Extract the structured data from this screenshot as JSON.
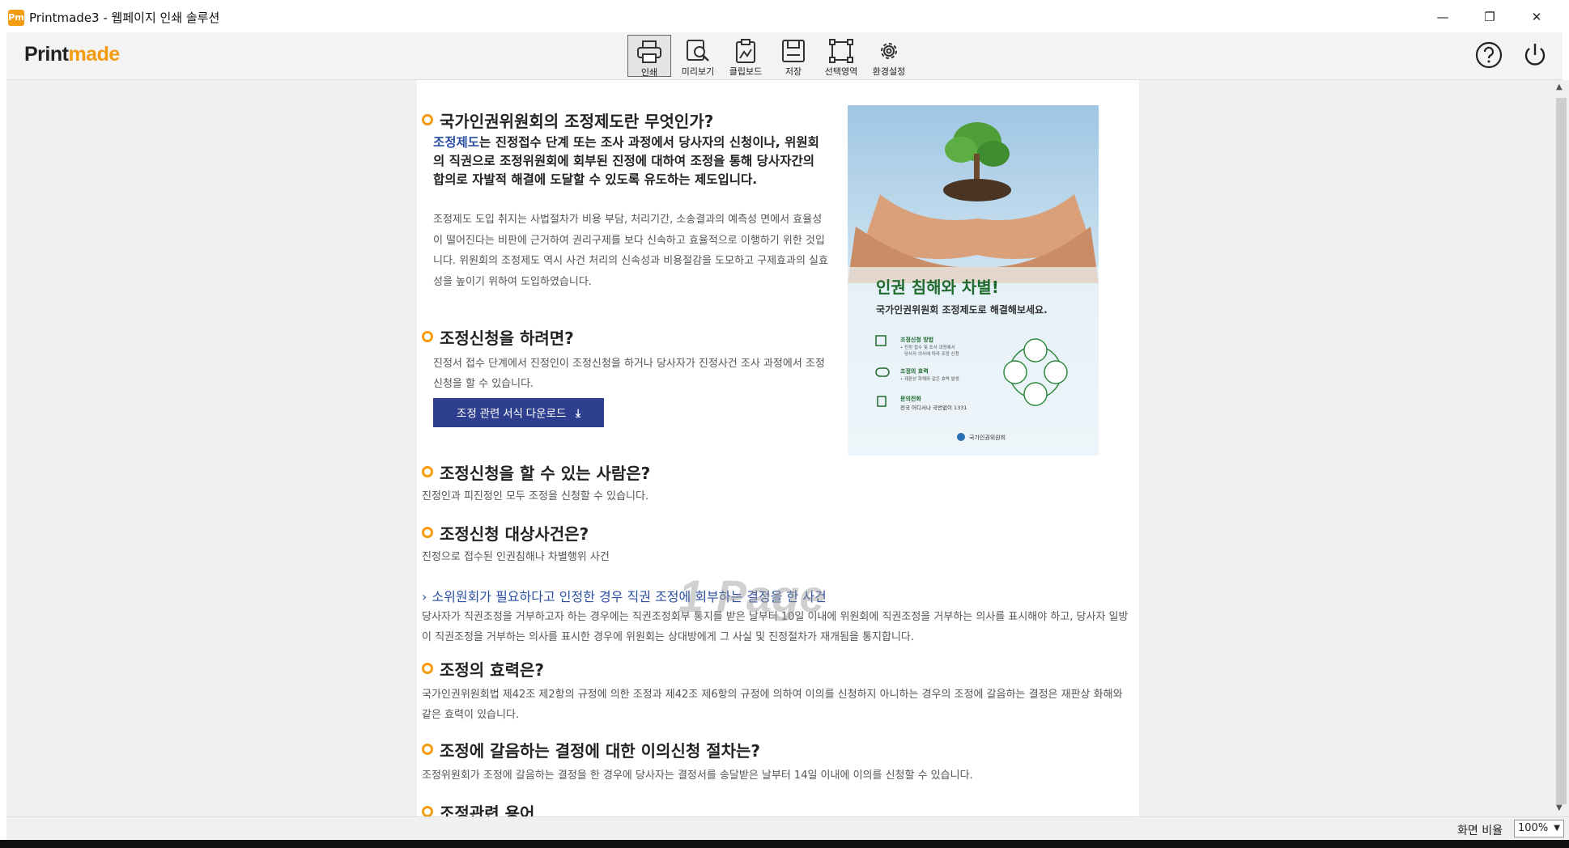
{
  "window": {
    "title": "Printmade3 - 웹페이지 인쇄 솔루션",
    "app_icon_text": "Pm",
    "controls": {
      "minimize": "—",
      "maximize": "❐",
      "close": "✕"
    }
  },
  "toolbar": {
    "brand_part1": "Print",
    "brand_part2": "made",
    "tools": [
      {
        "label": "인쇄",
        "icon": "printer-icon",
        "active": true
      },
      {
        "label": "미리보기",
        "icon": "preview-magnifier-icon"
      },
      {
        "label": "클립보드",
        "icon": "clipboard-icon"
      },
      {
        "label": "저장",
        "icon": "save-disk-icon"
      },
      {
        "label": "선택영역",
        "icon": "selection-area-icon"
      },
      {
        "label": "환경설정",
        "icon": "gear-icon"
      }
    ],
    "help_icon": "help-icon",
    "power_icon": "power-icon"
  },
  "content": {
    "s1_title": "국가인권위원회의 조정제도란 무엇인가?",
    "s1_lead_link": "조정제도",
    "s1_lead_rest": "는 진정접수 단계 또는 조사 과정에서 당사자의 신청이나, 위원회의 직권으로 조정위원회에 회부된 진정에 대하여 조정을 통해 당사자간의 합의로 자발적 해결에 도달할 수 있도록 유도하는 제도입니다.",
    "s1_body": "조정제도 도입 취지는 사법절차가 비용 부담, 처리기간, 소송결과의 예측성 면에서 효율성이 떨어진다는 비판에 근거하여 권리구제를 보다 신속하고 효율적으로 이행하기 위한 것입니다. 위원회의 조정제도 역시 사건 처리의 신속성과 비용절감을 도모하고 구제효과의 실효성을 높이기 위하여 도입하였습니다.",
    "s2_title": "조정신청을 하려면?",
    "s2_body": "진정서 접수 단계에서 진정인이 조정신청을 하거나 당사자가 진정사건 조사 과정에서 조정신청을 할 수 있습니다.",
    "download_button": "조정 관련 서식 다운로드",
    "s3_title": "조정신청을 할 수 있는 사람은?",
    "s3_body": "진정인과 피진정인 모두 조정을 신청할 수 있습니다.",
    "s4_title": "조정신청 대상사건은?",
    "s4_body": "진정으로 접수된 인권침해나 차별행위 사건",
    "s4_sublink": "소위원회가 필요하다고 인정한 경우 직권 조정에 회부하는 결정을 한 사건",
    "s4_subbody": "당사자가 직권조정을 거부하고자 하는 경우에는 직권조정회부 통지를 받은 날부터 10일 이내에 위원회에 직권조정을 거부하는 의사를 표시해야 하고, 당사자 일방이 직권조정을 거부하는 의사를 표시한 경우에 위원회는 상대방에게 그 사실 및 진정절차가 재개됨을 통지합니다.",
    "s5_title": "조정의 효력은?",
    "s5_body": "국가인권위원회법 제42조 제2항의 규정에 의한 조정과 제42조 제6항의 규정에 의하여 이의를 신청하지 아니하는 경우의 조정에 갈음하는 결정은 재판상 화해와 같은 효력이 있습니다.",
    "s6_title": "조정에 갈음하는 결정에 대한 이의신청 절차는?",
    "s6_body": "조정위원회가 조정에 갈음하는 결정을 한 경우에 당사자는 결정서를 송달받은 날부터 14일 이내에 이의를 신청할 수 있습니다.",
    "s7_title": "조정관련 용어",
    "watermark": "1 Page"
  },
  "poster": {
    "headline": "인권 침해와 차별!",
    "subheadline": "국가인권위원회 조정제도로 해결해보세요.",
    "rows": [
      {
        "title": "조정신청 방법",
        "desc1": "• 진정 접수 및 조사 과정에서",
        "desc2": "당사자 의사에 따라 조정 신청"
      },
      {
        "title": "조정의 효력",
        "desc1": "• 재판상 화해와 같은 효력 발생",
        "desc2": ""
      },
      {
        "title": "문의전화",
        "desc1": "전국 어디서나 국번없이 1331",
        "desc2": ""
      }
    ],
    "footer_logo": "국가인권위원회"
  },
  "status": {
    "zoom_label": "화면 비율",
    "zoom_value": "100%"
  },
  "colors": {
    "accent": "#f39c12",
    "link": "#2b4fa0",
    "button": "#2d3f8e",
    "poster_green": "#1f6b2e"
  }
}
